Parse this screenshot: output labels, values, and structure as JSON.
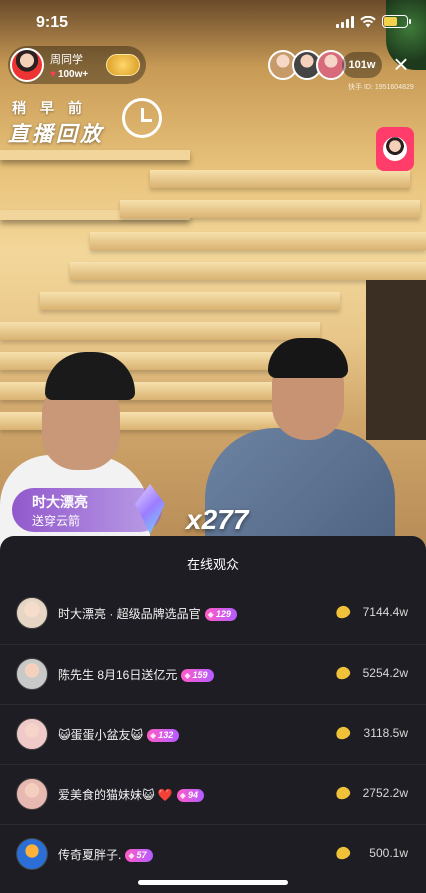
{
  "status_bar": {
    "time": "9:15"
  },
  "host": {
    "name": "周同学",
    "likes": "100w+"
  },
  "viewers": {
    "count": "101w",
    "kwai_id": "快手 ID: 1951604829"
  },
  "replay": {
    "top_text": "稍早前",
    "main_text": "直播回放"
  },
  "gift": {
    "sender": "时大漂亮",
    "action": "送穿云箭",
    "count": "x277"
  },
  "audience": {
    "title": "在线观众",
    "rows": [
      {
        "name": "时大漂亮 · 超级品牌选品官",
        "level": "129",
        "amount": "7144.4w",
        "avatar_color": "#e8d6c4"
      },
      {
        "name": "陈先生 8月16日送亿元",
        "level": "159",
        "amount": "5254.2w",
        "avatar_color": "#c9c9c9"
      },
      {
        "name": "😺蛋蛋小盆友😺",
        "level": "132",
        "amount": "3118.5w",
        "avatar_color": "#f0c9c9"
      },
      {
        "name": "爱美食的猫妹妹😺 ❤️",
        "level": "94",
        "amount": "2752.2w",
        "avatar_color": "#e7b9b0"
      },
      {
        "name": "传奇夏胖子.",
        "level": "57",
        "amount": "500.1w",
        "avatar_color": "#2b6fd6"
      }
    ]
  }
}
